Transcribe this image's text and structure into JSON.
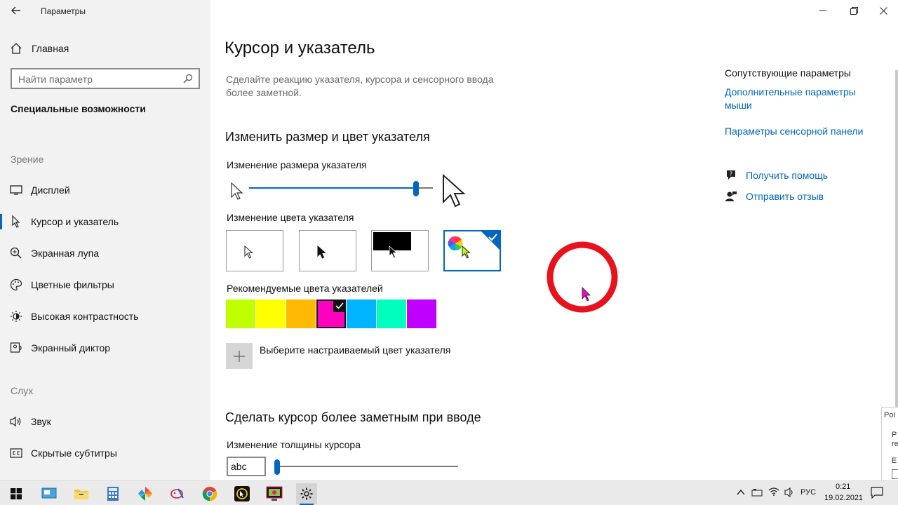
{
  "window": {
    "app_title": "Параметры",
    "back_icon": "arrow-left-icon",
    "controls": [
      "minimize-icon",
      "restore-icon",
      "close-icon"
    ]
  },
  "sidebar": {
    "home_label": "Главная",
    "search_placeholder": "Найти параметр",
    "section_title": "Специальные возможности",
    "groups": [
      {
        "label": "Зрение",
        "items": [
          {
            "label": "Дисплей",
            "icon": "monitor-icon"
          },
          {
            "label": "Курсор и указатель",
            "icon": "cursor-icon",
            "active": true
          },
          {
            "label": "Экранная лупа",
            "icon": "magnifier-icon"
          },
          {
            "label": "Цветные фильтры",
            "icon": "palette-icon"
          },
          {
            "label": "Высокая контрастность",
            "icon": "contrast-icon"
          },
          {
            "label": "Экранный диктор",
            "icon": "narrator-icon"
          }
        ]
      },
      {
        "label": "Слух",
        "items": [
          {
            "label": "Звук",
            "icon": "speaker-icon"
          },
          {
            "label": "Скрытые субтитры",
            "icon": "captions-icon"
          }
        ]
      }
    ]
  },
  "main": {
    "title": "Курсор и указатель",
    "description": "Сделайте реакцию указателя, курсора и сенсорного ввода более заметной.",
    "size_section": {
      "heading": "Изменить размер и цвет указателя",
      "size_label": "Изменение размера указателя",
      "size_value": 0.92,
      "color_label": "Изменение цвета указателя",
      "color_options": [
        "white",
        "black",
        "inverted",
        "custom"
      ],
      "selected_color_option": "custom",
      "recommended_label": "Рекомендуемые цвета указателей",
      "recommended_colors": [
        "#bfff00",
        "#ffff00",
        "#ffb900",
        "#ff00bf",
        "#00b4ff",
        "#00ffbf",
        "#bf00ff"
      ],
      "selected_recommended": "#ff00bf",
      "custom_label": "Выберите настраиваемый цвет указателя"
    },
    "typing_section": {
      "heading": "Сделать курсор более заметным при вводе",
      "thickness_label": "Изменение толщины курсора",
      "preview_text": "abc",
      "thickness_value": 0.0
    }
  },
  "related": {
    "title": "Сопутствующие параметры",
    "links": [
      "Дополнительные параметры мыши",
      "Параметры сенсорной панели"
    ],
    "help": [
      {
        "label": "Получить помощь",
        "icon": "help-chat-icon"
      },
      {
        "label": "Отправить отзыв",
        "icon": "feedback-icon"
      }
    ]
  },
  "popup": {
    "title": "Poi",
    "lines": [
      "P",
      "re",
      "E"
    ]
  },
  "taskbar": {
    "apps": [
      "windows-start-icon",
      "desktop-icon",
      "file-explorer-icon",
      "calculator-icon",
      "pinwheel-app-icon",
      "paint-icon",
      "chrome-icon",
      "cursor-app-icon",
      "screen-recorder-icon",
      "settings-icon"
    ],
    "language": "РУС",
    "time": "0:21",
    "date": "19.02.2021"
  }
}
